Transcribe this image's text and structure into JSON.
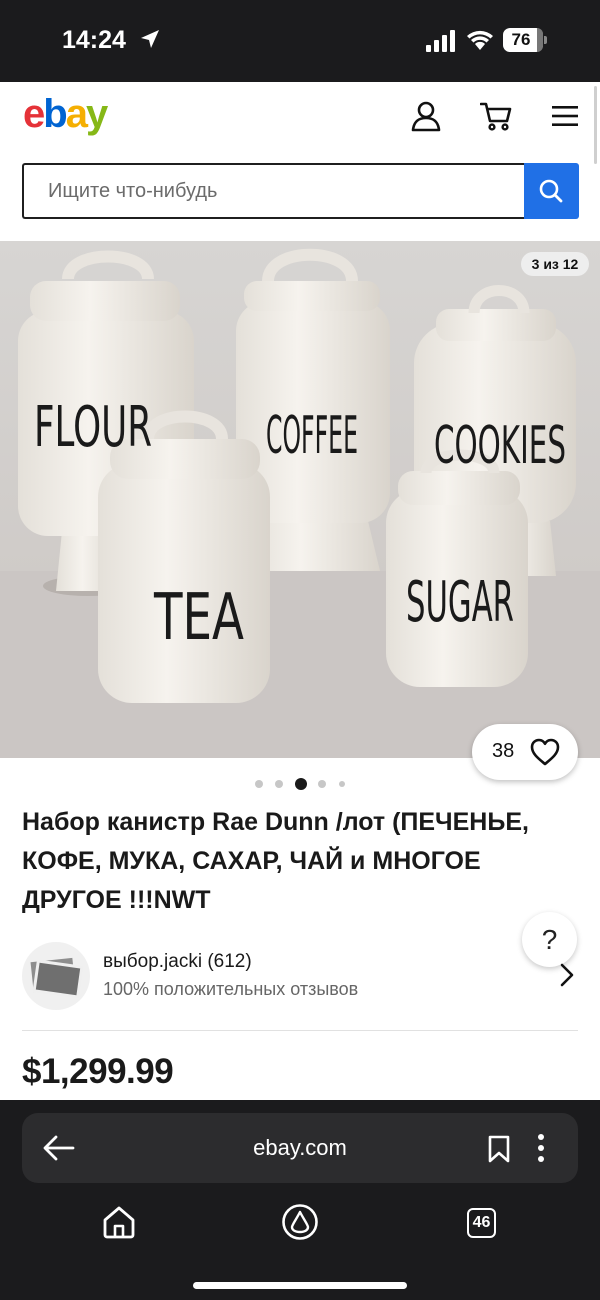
{
  "status_bar": {
    "time": "14:24",
    "battery": "76"
  },
  "header": {
    "logo": [
      "e",
      "b",
      "a",
      "y"
    ],
    "logo_colors": [
      "#e53238",
      "#0064d2",
      "#f5af02",
      "#86b817"
    ],
    "icons": [
      "profile-icon",
      "cart-icon",
      "menu-icon"
    ]
  },
  "search": {
    "placeholder": "Ищите что-нибудь",
    "button_color": "#2070e6"
  },
  "gallery": {
    "counter": "3 из 12",
    "likes": "38",
    "current_index": 3,
    "canisters": [
      "FLOUR",
      "COFFEE",
      "COOKIES",
      "TEA",
      "SUGAR"
    ]
  },
  "listing": {
    "title": "Набор канистр Rae Dunn /лот (ПЕЧЕНЬЕ, КОФЕ, МУКА, САХАР, ЧАЙ и МНОГОЕ ДРУГОЕ !!!NWT",
    "price": "$1,299.99"
  },
  "seller": {
    "name": "выбор.jacki (612)",
    "feedback": "100% положительных отзывов"
  },
  "help": {
    "label": "?"
  },
  "browser": {
    "url": "ebay.com",
    "tabs_count": "46"
  }
}
